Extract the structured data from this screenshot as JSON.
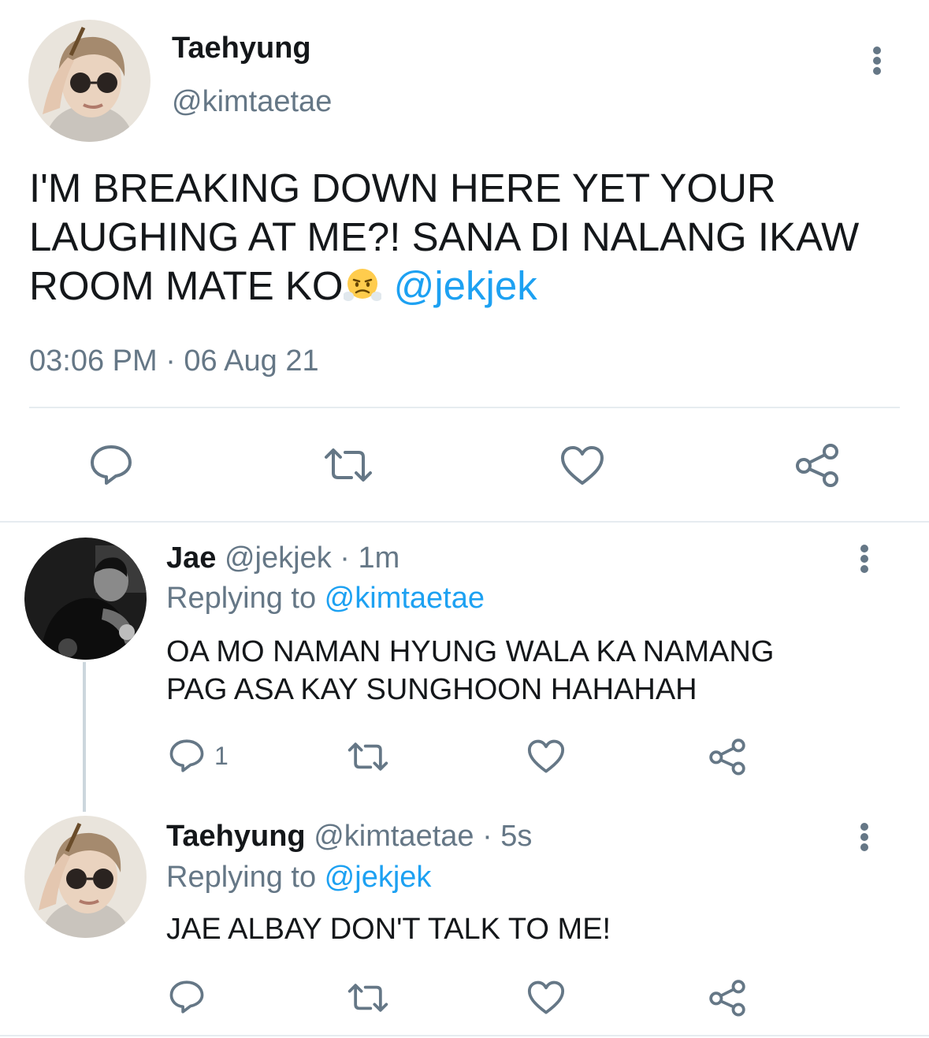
{
  "main_tweet": {
    "author_name": "Taehyung",
    "author_handle": "@kimtaetae",
    "text_line1": "I'M BREAKING DOWN HERE YET YOUR",
    "text_line2": "LAUGHING AT ME?! SANA DI NALANG IKAW",
    "text_line3": "ROOM MATE KO",
    "emoji": "face-with-steam-from-nose",
    "mention": "@jekjek",
    "timestamp": "03:06 PM · 06 Aug 21",
    "actions": [
      "reply-icon",
      "retweet-icon",
      "like-icon",
      "share-icon"
    ]
  },
  "replies": [
    {
      "author_name": "Jae",
      "meta": "@jekjek · 1m",
      "replying_label": "Replying to ",
      "replying_to": "@kimtaetae",
      "text_line1": "OA MO NAMAN HYUNG WALA KA NAMANG",
      "text_line2": "PAG ASA KAY SUNGHOON HAHAHAH",
      "reply_count": "1"
    },
    {
      "author_name": "Taehyung",
      "meta": "@kimtaetae · 5s",
      "replying_label": "Replying to ",
      "replying_to": "@jekjek",
      "text_line1": "JAE ALBAY DON'T TALK TO ME!",
      "reply_count": ""
    }
  ],
  "colors": {
    "accent": "#1da1f2",
    "secondary_text": "#657786",
    "icon": "#657786",
    "divider": "#e6ecf0"
  }
}
